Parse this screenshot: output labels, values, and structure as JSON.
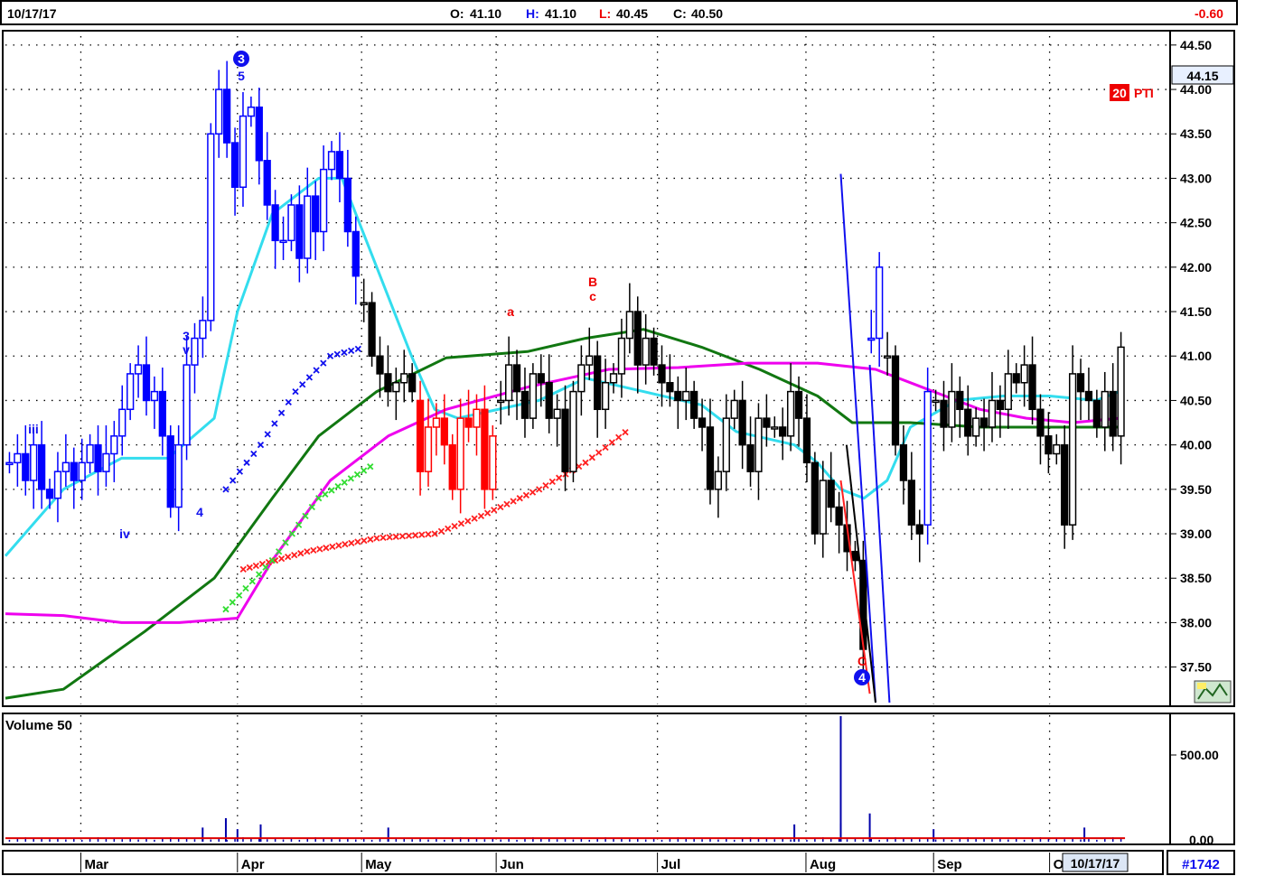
{
  "header": {
    "date": "10/17/17",
    "open_label": "O:",
    "open": "41.10",
    "high_label": "H:",
    "high": "41.10",
    "low_label": "L:",
    "low": "40.45",
    "close_label": "C:",
    "close": "40.50",
    "change": "-0.60"
  },
  "price_panel": {
    "last_price_box": "44.15",
    "pti_value": "20",
    "pti_label": "PTI",
    "wave_labels": [
      "3",
      "5",
      "iii",
      "3",
      "v",
      "4",
      "iv",
      "a",
      "B",
      "c",
      "C",
      "4"
    ]
  },
  "volume_panel": {
    "title": "Volume 50",
    "tick_labels": [
      "500.00",
      "0.00"
    ]
  },
  "footer": {
    "months": [
      "Mar",
      "Apr",
      "May",
      "Jun",
      "Jul",
      "Aug",
      "Sep",
      "O"
    ],
    "current_date": "10/17/17",
    "symbol_id": "#1742"
  },
  "colors": {
    "blue_candles": "#0000ff",
    "red_candles": "#ff0000",
    "cyan_ma": "#33ddee",
    "green_ma": "#117711",
    "magenta_ma": "#ee00ee",
    "red_trail": "#ff2020",
    "blue_trail": "#1010ee",
    "green_trail": "#33dd33",
    "volume_bar": "#0000aa",
    "volume_avg": "#dd0000"
  },
  "chart_data": {
    "type": "candlestick",
    "y_ticks": [
      "44.50",
      "44.00",
      "43.50",
      "43.00",
      "42.50",
      "42.00",
      "41.50",
      "41.00",
      "40.50",
      "40.00",
      "39.50",
      "39.00",
      "38.50",
      "38.00",
      "37.50"
    ],
    "ylim": [
      37.1,
      44.6
    ],
    "x_months": [
      "Mar",
      "Apr",
      "May",
      "Jun",
      "Jul",
      "Aug",
      "Sep",
      "O"
    ],
    "candle_segments": [
      {
        "color": "blue",
        "count": 34,
        "start_close": 39.8,
        "path": [
          39.8,
          39.9,
          39.6,
          40.0,
          39.5,
          39.4,
          39.7,
          39.8,
          39.6,
          39.8,
          40.0,
          39.7,
          39.9,
          40.1,
          40.4,
          40.8,
          40.9,
          40.5,
          40.6,
          40.1,
          39.3,
          40.0,
          40.9,
          41.2,
          41.4,
          43.5,
          44.0,
          43.4,
          42.9,
          43.7,
          43.8,
          43.2,
          42.7,
          42.3
        ]
      },
      {
        "color": "blue",
        "count": 10,
        "start_close": 42.3,
        "path": [
          42.3,
          42.7,
          42.1,
          42.8,
          42.4,
          43.1,
          43.3,
          43.0,
          42.4,
          41.9
        ]
      },
      {
        "color": "black",
        "count": 7,
        "start_close": 41.6,
        "path": [
          41.6,
          41.0,
          40.8,
          40.6,
          40.7,
          40.8,
          40.6
        ]
      },
      {
        "color": "red",
        "count": 10,
        "start_close": 40.5,
        "path": [
          39.7,
          40.2,
          40.3,
          40.0,
          39.5,
          40.3,
          40.2,
          40.4,
          39.5,
          40.1
        ]
      },
      {
        "color": "black",
        "count": 34,
        "start_close": 40.5,
        "path": [
          40.5,
          40.9,
          40.6,
          40.3,
          40.8,
          40.7,
          40.3,
          40.4,
          39.7,
          40.6,
          40.9,
          41.0,
          40.4,
          40.7,
          40.8,
          41.2,
          41.5,
          40.9,
          41.2,
          40.9,
          40.7,
          40.6,
          40.5,
          40.6,
          40.3,
          40.2,
          39.5,
          39.7,
          40.3,
          40.5,
          40.0,
          39.7,
          40.3,
          40.2
        ]
      },
      {
        "color": "black",
        "count": 12,
        "start_close": 40.2,
        "path": [
          40.2,
          40.1,
          40.6,
          40.3,
          39.8,
          39.0,
          39.6,
          39.3,
          39.1,
          38.8,
          38.7,
          37.7
        ]
      },
      {
        "color": "blue",
        "count": 2,
        "start_close": 41.2,
        "path": [
          41.2,
          42.0
        ]
      },
      {
        "color": "black",
        "count": 5,
        "start_close": 41.0,
        "path": [
          41.0,
          40.0,
          39.6,
          39.1,
          39.0
        ]
      },
      {
        "color": "blue",
        "count": 1,
        "start_close": 39.1,
        "path": [
          40.6
        ]
      },
      {
        "color": "black",
        "count": 24,
        "start_close": 40.5,
        "path": [
          40.5,
          40.2,
          40.6,
          40.4,
          40.1,
          40.3,
          40.2,
          40.5,
          40.4,
          40.8,
          40.7,
          40.9,
          40.4,
          40.1,
          39.9,
          40.0,
          39.1,
          40.8,
          40.6,
          40.5,
          40.2,
          40.6,
          40.1,
          41.1
        ]
      }
    ],
    "series": [
      {
        "name": "",
        "color": "cyan",
        "points": [
          [
            0,
            38.75
          ],
          [
            0.05,
            39.5
          ],
          [
            0.1,
            39.85
          ],
          [
            0.14,
            39.85
          ],
          [
            0.18,
            40.3
          ],
          [
            0.2,
            41.5
          ],
          [
            0.23,
            42.6
          ],
          [
            0.27,
            43.0
          ],
          [
            0.29,
            43.0
          ],
          [
            0.32,
            42.0
          ],
          [
            0.35,
            41.0
          ],
          [
            0.37,
            40.4
          ],
          [
            0.39,
            40.3
          ],
          [
            0.46,
            40.5
          ],
          [
            0.5,
            40.75
          ],
          [
            0.55,
            40.6
          ],
          [
            0.6,
            40.45
          ],
          [
            0.63,
            40.15
          ],
          [
            0.68,
            40.0
          ],
          [
            0.7,
            39.8
          ],
          [
            0.72,
            39.5
          ],
          [
            0.74,
            39.4
          ],
          [
            0.76,
            39.6
          ],
          [
            0.78,
            40.2
          ],
          [
            0.82,
            40.5
          ],
          [
            0.86,
            40.55
          ],
          [
            0.9,
            40.55
          ],
          [
            0.94,
            40.5
          ],
          [
            0.96,
            40.6
          ]
        ]
      },
      {
        "name": "",
        "color": "green",
        "points": [
          [
            0,
            37.15
          ],
          [
            0.05,
            37.25
          ],
          [
            0.12,
            37.9
          ],
          [
            0.18,
            38.5
          ],
          [
            0.23,
            39.4
          ],
          [
            0.27,
            40.1
          ],
          [
            0.32,
            40.6
          ],
          [
            0.38,
            40.98
          ],
          [
            0.45,
            41.05
          ],
          [
            0.5,
            41.2
          ],
          [
            0.55,
            41.3
          ],
          [
            0.6,
            41.1
          ],
          [
            0.65,
            40.85
          ],
          [
            0.7,
            40.55
          ],
          [
            0.73,
            40.25
          ],
          [
            0.78,
            40.25
          ],
          [
            0.84,
            40.2
          ],
          [
            0.9,
            40.2
          ],
          [
            0.96,
            40.2
          ]
        ]
      },
      {
        "name": "",
        "color": "magenta",
        "points": [
          [
            0,
            38.1
          ],
          [
            0.05,
            38.08
          ],
          [
            0.1,
            38.0
          ],
          [
            0.15,
            38.0
          ],
          [
            0.2,
            38.05
          ],
          [
            0.23,
            38.7
          ],
          [
            0.28,
            39.6
          ],
          [
            0.33,
            40.1
          ],
          [
            0.38,
            40.4
          ],
          [
            0.45,
            40.65
          ],
          [
            0.52,
            40.85
          ],
          [
            0.58,
            40.87
          ],
          [
            0.64,
            40.92
          ],
          [
            0.7,
            40.92
          ],
          [
            0.75,
            40.85
          ],
          [
            0.8,
            40.6
          ],
          [
            0.84,
            40.4
          ],
          [
            0.88,
            40.3
          ],
          [
            0.92,
            40.25
          ],
          [
            0.96,
            40.3
          ]
        ]
      },
      {
        "name": "",
        "color": "red",
        "marker": "x",
        "points": [
          [
            0.205,
            38.6
          ],
          [
            0.26,
            38.8
          ],
          [
            0.32,
            38.95
          ],
          [
            0.37,
            39.0
          ],
          [
            0.41,
            39.2
          ],
          [
            0.46,
            39.5
          ],
          [
            0.5,
            39.8
          ],
          [
            0.54,
            40.2
          ]
        ]
      },
      {
        "name": "",
        "color": "blue",
        "marker": "x",
        "points": [
          [
            0.19,
            39.5
          ],
          [
            0.22,
            40.0
          ],
          [
            0.25,
            40.6
          ],
          [
            0.28,
            41.0
          ],
          [
            0.31,
            41.1
          ]
        ]
      },
      {
        "name": "",
        "color": "green",
        "marker": "x",
        "points": [
          [
            0.19,
            38.15
          ],
          [
            0.23,
            38.7
          ],
          [
            0.27,
            39.4
          ],
          [
            0.32,
            39.8
          ]
        ]
      }
    ],
    "trendlines": [
      {
        "color": "blue",
        "from": [
          0.72,
          43.05
        ],
        "to": [
          0.75,
          37.1
        ]
      },
      {
        "color": "red",
        "from": [
          0.72,
          39.6
        ],
        "to": [
          0.745,
          37.2
        ]
      },
      {
        "color": "black",
        "from": [
          0.725,
          40.0
        ],
        "to": [
          0.75,
          37.1
        ]
      },
      {
        "color": "blue",
        "from": [
          0.745,
          40.9
        ],
        "to": [
          0.762,
          37.1
        ]
      }
    ],
    "volume": {
      "ylim": [
        0,
        800
      ],
      "typical": 20,
      "spikes": [
        [
          0.72,
          800
        ],
        [
          0.19,
          150
        ],
        [
          0.2,
          80
        ],
        [
          0.22,
          110
        ],
        [
          0.17,
          90
        ],
        [
          0.33,
          90
        ],
        [
          0.68,
          110
        ],
        [
          0.72,
          120
        ],
        [
          0.745,
          180
        ],
        [
          0.8,
          80
        ],
        [
          0.93,
          90
        ]
      ],
      "avg": 22
    }
  }
}
